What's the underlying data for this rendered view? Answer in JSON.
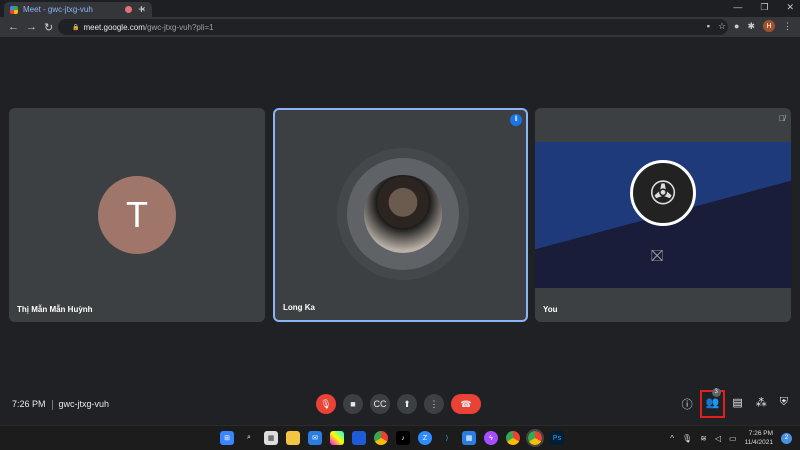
{
  "browser": {
    "tab_title": "Meet - gwc-jtxg-vuh",
    "url_host": "meet.google.com",
    "url_path": "/gwc-jtxg-vuh?pli=1",
    "profile_initial": "H"
  },
  "tiles": [
    {
      "name": "Thị Mẫn Mẫn Huỳnh",
      "initial": "T"
    },
    {
      "name": "Long Ka"
    },
    {
      "name": "You"
    }
  ],
  "meeting": {
    "time": "7:26 PM",
    "code": "gwc-jtxg-vuh",
    "participant_count": "3"
  },
  "taskbar": {
    "time": "7:26 PM",
    "date": "11/4/2021",
    "notifications": "2"
  },
  "colors": {
    "accent": "#8ab4f8",
    "end_call": "#ea4335",
    "background": "#202124"
  }
}
